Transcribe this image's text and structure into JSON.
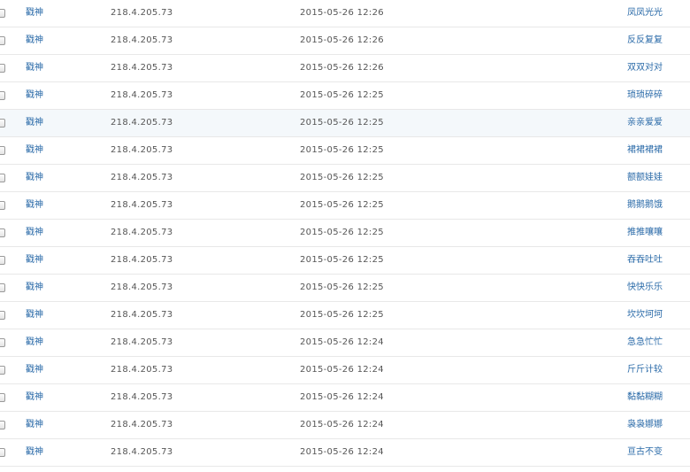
{
  "log": {
    "rows": [
      {
        "user": "戳神",
        "ip": "218.4.205.73",
        "time": "2015-05-26 12:26",
        "word": "凤凤光光"
      },
      {
        "user": "戳神",
        "ip": "218.4.205.73",
        "time": "2015-05-26 12:26",
        "word": "反反复复"
      },
      {
        "user": "戳神",
        "ip": "218.4.205.73",
        "time": "2015-05-26 12:26",
        "word": "双双对对"
      },
      {
        "user": "戳神",
        "ip": "218.4.205.73",
        "time": "2015-05-26 12:25",
        "word": "琐琐碎碎"
      },
      {
        "user": "戳神",
        "ip": "218.4.205.73",
        "time": "2015-05-26 12:25",
        "word": "亲亲爱爱"
      },
      {
        "user": "戳神",
        "ip": "218.4.205.73",
        "time": "2015-05-26 12:25",
        "word": "裙裙裙裙"
      },
      {
        "user": "戳神",
        "ip": "218.4.205.73",
        "time": "2015-05-26 12:25",
        "word": "额额娃娃"
      },
      {
        "user": "戳神",
        "ip": "218.4.205.73",
        "time": "2015-05-26 12:25",
        "word": "鹅鹅鹅饿"
      },
      {
        "user": "戳神",
        "ip": "218.4.205.73",
        "time": "2015-05-26 12:25",
        "word": "推推嚷嚷"
      },
      {
        "user": "戳神",
        "ip": "218.4.205.73",
        "time": "2015-05-26 12:25",
        "word": "吞吞吐吐"
      },
      {
        "user": "戳神",
        "ip": "218.4.205.73",
        "time": "2015-05-26 12:25",
        "word": "快快乐乐"
      },
      {
        "user": "戳神",
        "ip": "218.4.205.73",
        "time": "2015-05-26 12:25",
        "word": "坎坎坷坷"
      },
      {
        "user": "戳神",
        "ip": "218.4.205.73",
        "time": "2015-05-26 12:24",
        "word": "急急忙忙"
      },
      {
        "user": "戳神",
        "ip": "218.4.205.73",
        "time": "2015-05-26 12:24",
        "word": "斤斤计较"
      },
      {
        "user": "戳神",
        "ip": "218.4.205.73",
        "time": "2015-05-26 12:24",
        "word": "黏黏糊糊"
      },
      {
        "user": "戳神",
        "ip": "218.4.205.73",
        "time": "2015-05-26 12:24",
        "word": "袅袅娜娜"
      },
      {
        "user": "戳神",
        "ip": "218.4.205.73",
        "time": "2015-05-26 12:24",
        "word": "亘古不变"
      }
    ],
    "hover_row_index": 4
  },
  "colors": {
    "link": "#2a6aa8",
    "text": "#555555",
    "divider": "#e8e8e8",
    "hover_background": "#f4f8fb"
  }
}
